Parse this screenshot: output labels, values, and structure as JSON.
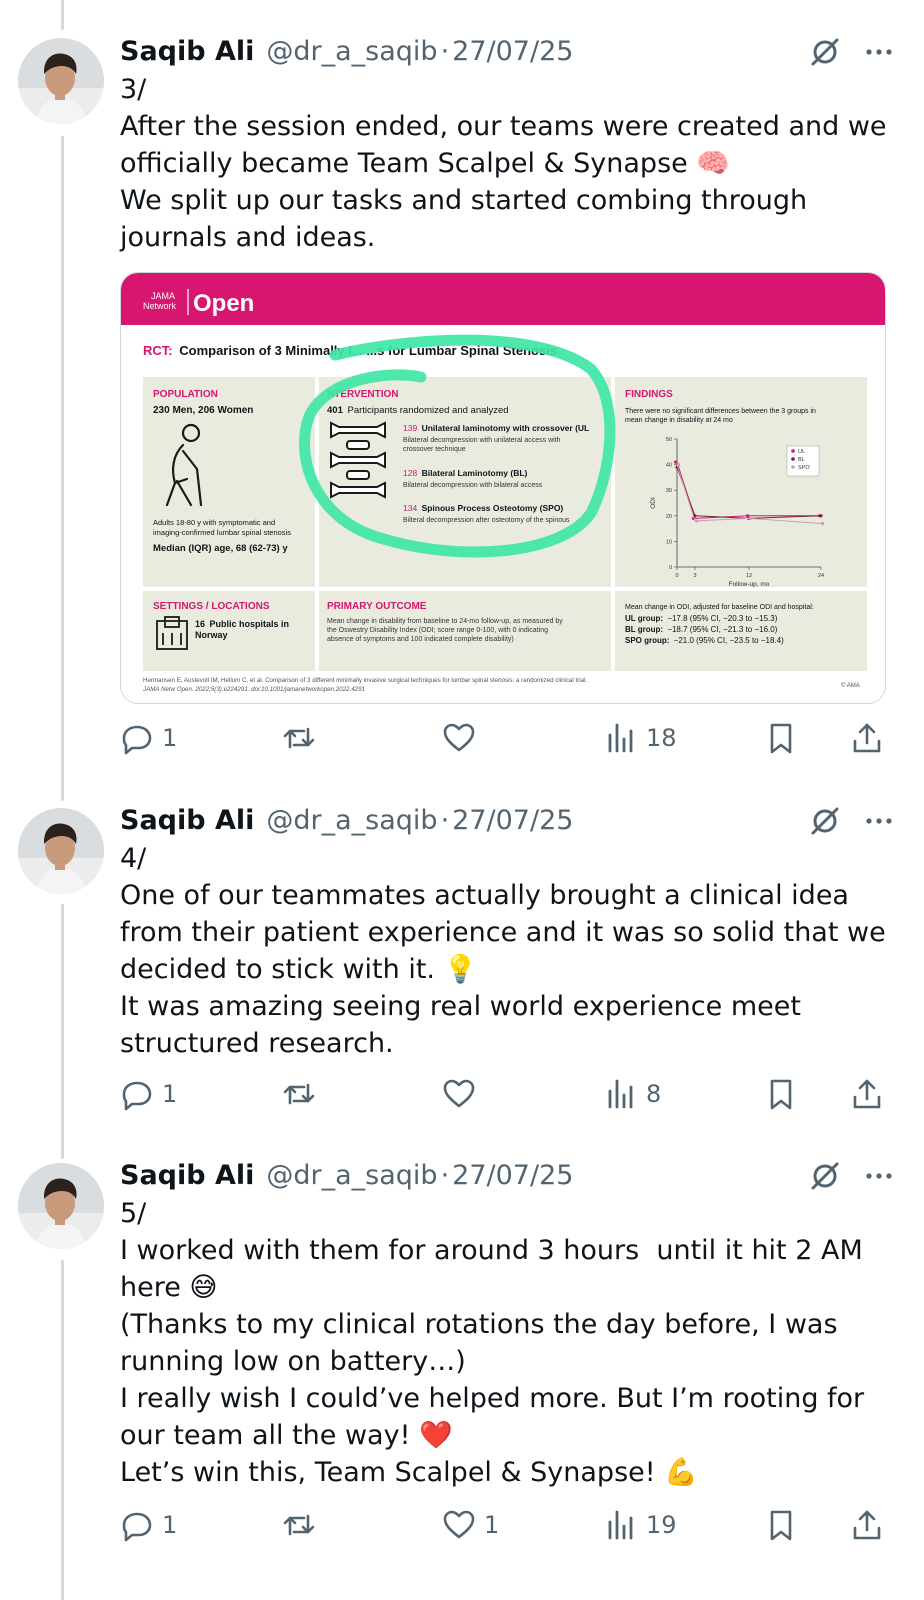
{
  "tweets": [
    {
      "author": "Saqib Ali",
      "handle": "@dr_a_saqib",
      "separator": "·",
      "date": "27/07/25",
      "text": "3/\nAfter the session ended, our teams were created and we officially became Team Scalpel & Synapse 🧠\nWe split up our tasks and started combing through journals and ideas.",
      "replies": "1",
      "reposts": "",
      "likes": "",
      "views": "18"
    },
    {
      "author": "Saqib Ali",
      "handle": "@dr_a_saqib",
      "separator": "·",
      "date": "27/07/25",
      "text": "4/\nOne of our teammates actually brought a clinical idea from their patient experience and it was so solid that we decided to stick with it. 💡\nIt was amazing seeing real world experience meet structured research.",
      "replies": "1",
      "reposts": "",
      "likes": "",
      "views": "8"
    },
    {
      "author": "Saqib Ali",
      "handle": "@dr_a_saqib",
      "separator": "·",
      "date": "27/07/25",
      "text": "5/\nI worked with them for around 3 hours  until it hit 2 AM here 😅\n(Thanks to my clinical rotations the day before, I was running low on battery…)\nI really wish I could’ve helped more. But I’m rooting for our team all the way! ❤️\nLet’s win this, Team Scalpel & Synapse! 💪",
      "replies": "1",
      "reposts": "",
      "likes": "1",
      "views": "19"
    }
  ],
  "icons": {
    "reply": "reply-icon",
    "repost": "repost-icon",
    "like": "like-icon",
    "views": "views-icon",
    "bookmark": "bookmark-icon",
    "share": "share-icon",
    "grok": "grok-icon",
    "more": "more-icon"
  },
  "colors": {
    "text": "#0f1419",
    "secondary": "#536471",
    "thread_line": "#cfd9de",
    "jama_pink": "#d6166f",
    "highlight_green": "#3fe6a6",
    "panel_bg": "#e9ebdf"
  },
  "infographic": {
    "brand_small": "JAMA\nNetwork",
    "brand_big": "Open",
    "rct_label": "RCT:",
    "title": "Comparison of 3 Minimally I... ...s for Lumbar Spinal Stenosis",
    "population": {
      "heading": "POPULATION",
      "headline": "230 Men, 206 Women",
      "note": "Adults 18-80 y with symptomatic and imaging-confirmed lumbar spinal stenosis",
      "median": "Median (IQR) age, 68 (62-73) y"
    },
    "intervention": {
      "heading": "NTERVENTION",
      "count_num": "401",
      "count_text": "Participants randomized and analyzed",
      "arms": [
        {
          "num": "139",
          "name": "Unilateral laminotomy with crossover (UL",
          "desc": "Bilateral decompression with unilateral access with crossover technique"
        },
        {
          "num": "128",
          "name": "Bilateral Laminotomy (BL)",
          "desc": "Bilateral decompression with bilateral access"
        },
        {
          "num": "134",
          "name": "Spinous Process Osteotomy (SPO)",
          "desc": "Bilteral decompression after osteotomy of the spinous"
        }
      ]
    },
    "findings": {
      "heading": "FINDINGS",
      "text": "There were no significant differences between the 3 groups in mean change in disability at 24 mo"
    },
    "settings": {
      "heading": "SETTINGS / LOCATIONS",
      "count": "16",
      "text": "Public hospitals in Norway"
    },
    "primary_outcome": {
      "heading": "PRIMARY OUTCOME",
      "text": "Mean change in disability from baseline to 24-mo follow-up, as measured by the Oswestry Disability Index (ODI; score range 0-100, with 0 indicating absence of symptoms and 100 indicated complete disability)"
    },
    "results": {
      "intro": "Mean change in ODI, adjusted for baseline ODI and hospital:",
      "lines": [
        {
          "group": "UL group:",
          "value": "−17.8 (95% CI, −20.3 to −15.3)"
        },
        {
          "group": "BL group:",
          "value": "−18.7 (95% CI, −21.3 to −16.0)"
        },
        {
          "group": "SPO group:",
          "value": "−21.0 (95% CI, −23.5 to −18.4)"
        }
      ]
    },
    "citation1": "Hermansen E, Austevoll IM, Hellum C, et al. Comparison of 3 different minimally invasive surgical techniques for lumbar spinal stenosis: a randomized clinical trial.",
    "citation2": "JAMA Netw Open. 2022;5(3):e224291. doi:10.1001/jamanetworkopen.2022.4291",
    "copyright": "© AMA"
  },
  "chart_data": {
    "type": "line",
    "xlabel": "Follow-up, mo",
    "ylabel": "ODI",
    "x": [
      0,
      3,
      12,
      24
    ],
    "xticks": [
      "0",
      "3",
      "12",
      "24"
    ],
    "yticks": [
      "0",
      "10",
      "20",
      "30",
      "40",
      "50"
    ],
    "ylim": [
      0,
      50
    ],
    "grid": false,
    "legend": "top-right",
    "series": [
      {
        "name": "UL",
        "color": "#d6166f",
        "values": [
          41,
          19,
          20,
          20
        ]
      },
      {
        "name": "BL",
        "color": "#7a1f3d",
        "values": [
          39,
          20,
          19,
          20
        ]
      },
      {
        "name": "SPO",
        "color": "#c9a0b4",
        "values": [
          40,
          18,
          19,
          17
        ]
      }
    ]
  }
}
